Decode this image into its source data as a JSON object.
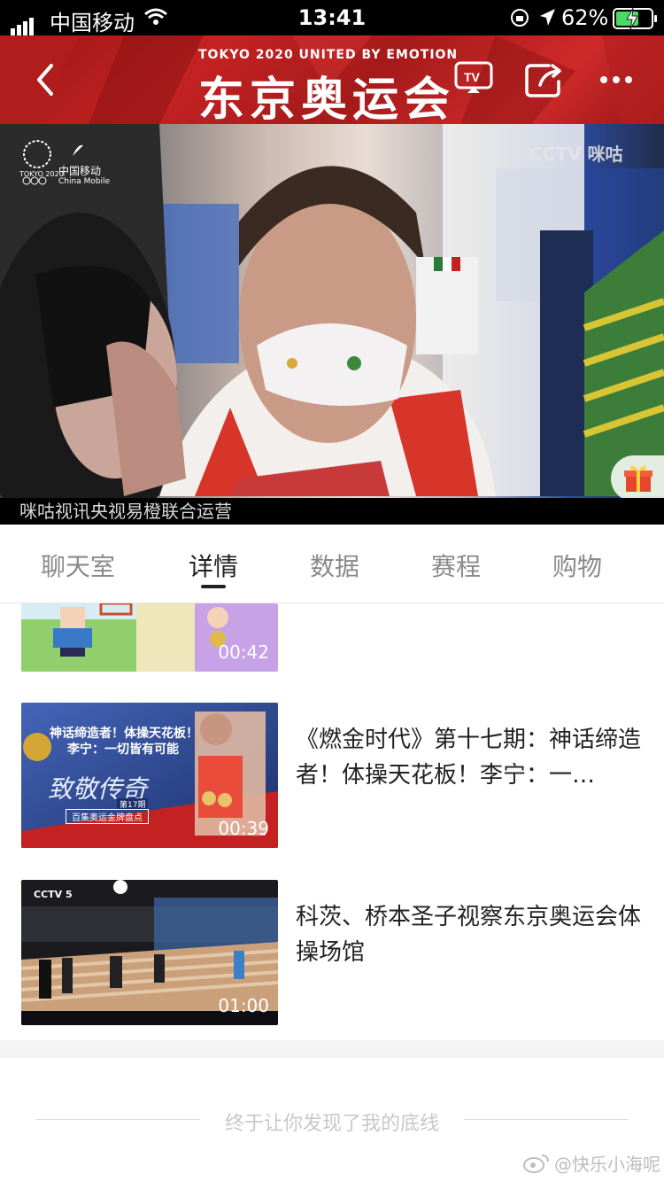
{
  "status_bar": {
    "carrier": "中国移动",
    "time": "13:41",
    "battery_percent": "62%"
  },
  "header": {
    "tagline": "TOKYO   2020   UNITED   BY   EMOTION",
    "title": "东京奥运会",
    "tv_label": "TV"
  },
  "video": {
    "olympic_logo_line1": "TOKYO 2020",
    "olympic_logo_line2": "中国移动",
    "olympic_logo_line3": "China Mobile",
    "broadcaster_mark": "CCTV 咪咕",
    "caption": "咪咕视讯央视易橙联合运营"
  },
  "tabs": [
    {
      "label": "聊天室",
      "active": false
    },
    {
      "label": "详情",
      "active": true
    },
    {
      "label": "数据",
      "active": false
    },
    {
      "label": "赛程",
      "active": false
    },
    {
      "label": "购物",
      "active": false
    }
  ],
  "videos": [
    {
      "duration": "00:42",
      "title": ""
    },
    {
      "duration": "00:39",
      "title": "《燃金时代》第十七期：神话缔造者！体操天花板！李宁：一…",
      "thumb_text1": "神话缔造者！体操天花板！",
      "thumb_text2": "李宁：一切皆有可能",
      "thumb_text3": "致敬传奇",
      "thumb_text4": "第17期",
      "thumb_text5": "百集奥运金牌盘点"
    },
    {
      "duration": "01:00",
      "title": "科茨、桥本圣子视察东京奥运会体操场馆",
      "thumb_text1": "CCTV 5"
    }
  ],
  "footer": {
    "end_text": "终于让你发现了我的底线",
    "watermark": "@快乐小海呢"
  },
  "colors": {
    "header_red": "#c42222",
    "active_tab": "#222222",
    "inactive_tab": "#8a8a8a"
  }
}
